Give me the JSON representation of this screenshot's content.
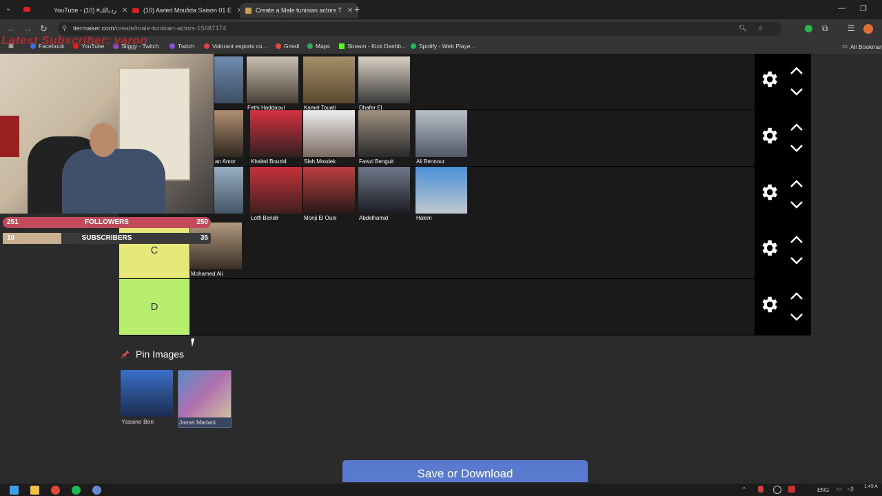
{
  "browser": {
    "tabs": [
      {
        "label": "YouTube - ردبالك# (10)"
      },
      {
        "label": "(10) Awled Moufida Saison 01 E"
      },
      {
        "label": "Create a Male tunisian actors T"
      }
    ],
    "url_host": "tiermaker.com",
    "url_path": "/create/male-tunisian-actors-15687174",
    "bookmarks": [
      {
        "label": "Facebook"
      },
      {
        "label": "YouTube"
      },
      {
        "label": "Sliggy - Twitch"
      },
      {
        "label": "Twitch"
      },
      {
        "label": "Valorant esports co..."
      },
      {
        "label": "Gmail"
      },
      {
        "label": "Maps"
      },
      {
        "label": "Stream - Kick Dashb..."
      },
      {
        "label": "Spotify - Web Playe..."
      }
    ],
    "all_bookmarks": "All Bookmar"
  },
  "stream": {
    "latest_subscriber": "Latest Subscriber: yaron",
    "followers": {
      "left": "251",
      "label": "FOLLOWERS",
      "right": "250",
      "progress": 1.0
    },
    "subscribers": {
      "left": "10",
      "label": "SUBSCRIBERS",
      "right": "35",
      "progress": 0.29
    }
  },
  "tiers": [
    {
      "label": "",
      "color": "#1a1a1a",
      "items": [
        "",
        "Fethi Haddaoui",
        "Kamel Touati",
        "Dhafer El"
      ]
    },
    {
      "label": "",
      "color": "#1a1a1a",
      "items": [
        "an Amor",
        "Khaled Bouzid",
        "Slah Mosdek",
        "Fawzi Benguit",
        "Ali Bennour"
      ]
    },
    {
      "label": "",
      "color": "#1a1a1a",
      "items": [
        "",
        "Lotfi Bendir",
        "Monji El Ouni",
        "Abdelhamid",
        "Hakim"
      ]
    },
    {
      "label": "C",
      "color": "#e6e87a",
      "items": [
        "Mohamed Ali"
      ]
    },
    {
      "label": "D",
      "color": "#b8ee6e",
      "items": []
    }
  ],
  "pin_images": {
    "title": "Pin Images",
    "items": [
      "Yassine Ben",
      "Jamel Madani"
    ]
  },
  "save_button": "Save or Download",
  "taskbar": {
    "lang": "ENG",
    "time": "1:49 A"
  }
}
